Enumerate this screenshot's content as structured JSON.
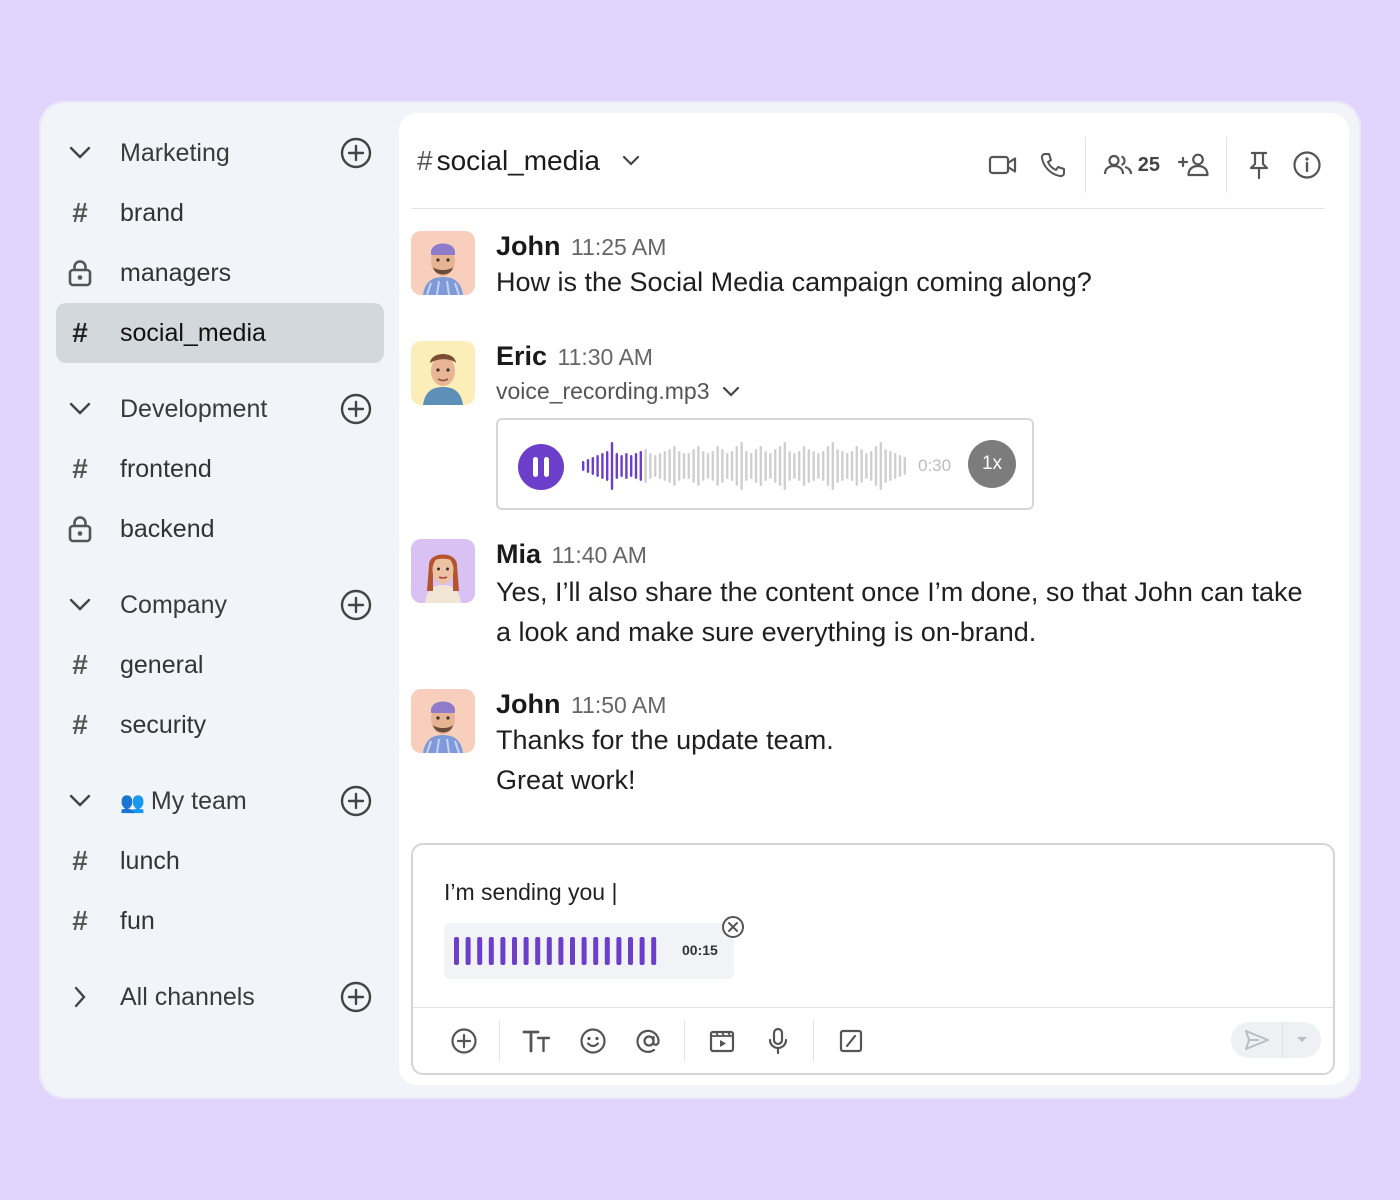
{
  "sidebar": {
    "sections": [
      {
        "label": "Marketing",
        "channels": [
          {
            "label": "brand",
            "icon": "hash-icon"
          },
          {
            "label": "managers",
            "icon": "lock-icon"
          },
          {
            "label": "social_media",
            "icon": "hash-icon",
            "active": true
          }
        ]
      },
      {
        "label": "Development",
        "channels": [
          {
            "label": "frontend",
            "icon": "hash-icon"
          },
          {
            "label": "backend",
            "icon": "lock-icon"
          }
        ]
      },
      {
        "label": "Company",
        "channels": [
          {
            "label": "general",
            "icon": "hash-icon"
          },
          {
            "label": "security",
            "icon": "hash-icon"
          }
        ]
      },
      {
        "label": "My team",
        "emoji": "👥",
        "channels": [
          {
            "label": "lunch",
            "icon": "hash-icon"
          },
          {
            "label": "fun",
            "icon": "hash-icon"
          }
        ]
      }
    ],
    "all_channels_label": "All channels"
  },
  "header": {
    "hash": "#",
    "channel": "social_media",
    "member_count": "25"
  },
  "messages": [
    {
      "author": "John",
      "time": "11:25 AM",
      "lines": [
        "How is the Social Media campaign coming along?"
      ]
    },
    {
      "author": "Eric",
      "time": "11:30 AM",
      "file": "voice_recording.mp3",
      "audio": {
        "duration": "0:30",
        "speed": "1x",
        "progress": 0.18
      }
    },
    {
      "author": "Mia",
      "time": "11:40 AM",
      "lines": [
        "Yes, I’ll also share the content once I’m done, so that John can take",
        "a look and make sure everything is on-brand."
      ]
    },
    {
      "author": "John",
      "time": "11:50 AM",
      "lines": [
        "Thanks for the update team.",
        "Great work!"
      ]
    }
  ],
  "composer": {
    "text": "I’m sending you |",
    "recording_duration": "00:15"
  },
  "colors": {
    "background": "#e1d4fd",
    "accent": "#6b3fc9",
    "active_channel": "#d3d8dd"
  }
}
